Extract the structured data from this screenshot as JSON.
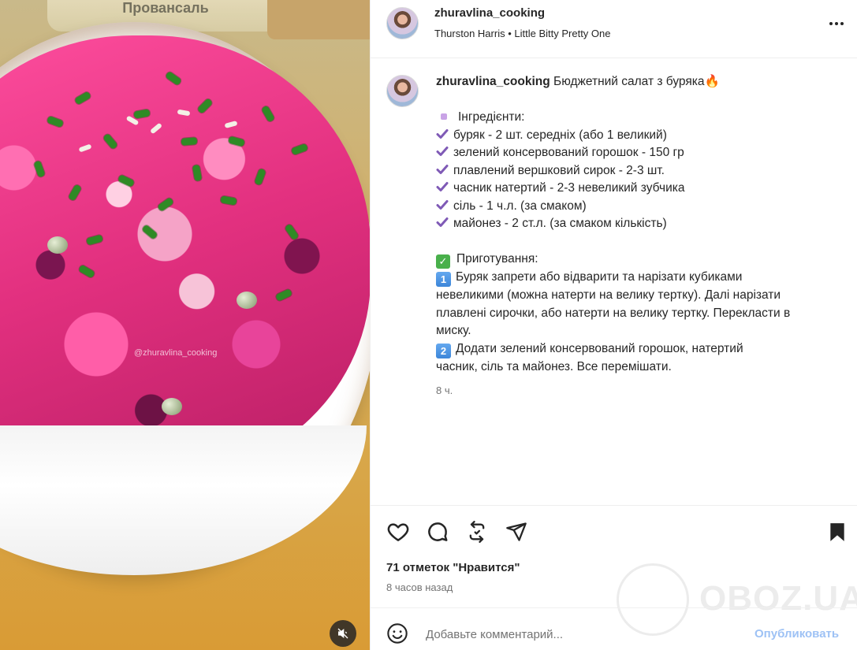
{
  "media": {
    "jar_label": "Провансаль",
    "watermark": "@zhuravlina_cooking",
    "mute_icon": "speaker-muted-icon"
  },
  "header": {
    "username": "zhuravlina_cooking",
    "audio_artist": "Thurston Harris",
    "audio_separator": "•",
    "audio_track": "Little Bitty Pretty One",
    "more_icon": "more-options-icon"
  },
  "caption": {
    "username": "zhuravlina_cooking",
    "title": "Бюджетний салат з буряка🔥",
    "ingredients_header": "Інгредієнти:",
    "ingredients": [
      "буряк - 2 шт. середніх (або 1 великий)",
      "зелений консервований горошок - 150 гр",
      "плавлений вершковий сирок - 2-3 шт.",
      "часник натертий - 2-3 невеликий зубчика",
      "сіль - 1 ч.л. (за смаком)",
      "майонез - 2 ст.л. (за смаком кількість)"
    ],
    "steps_header": "Приготування:",
    "step1_key": "1",
    "step1_lines": [
      "Буряк запрети або відварити та нарізати кубиками",
      "невеликими (можна натерти на велику тертку). Далі нарізати",
      "плавлені сирочки, або натерти на велику тертку. Перекласти в",
      "миску."
    ],
    "step2_key": "2",
    "step2_lines": [
      "Додати зелений консервований горошок, натертий",
      "часник, сіль та майонез. Все перемішати."
    ],
    "time": "8 ч."
  },
  "actions": {
    "like_icon": "heart-icon",
    "comment_icon": "comment-icon",
    "repost_icon": "repost-icon",
    "share_icon": "send-icon",
    "save_icon": "bookmark-icon",
    "likes": "71 отметок \"Нравится\"",
    "posted": "8 часов назад"
  },
  "comment": {
    "emoji_icon": "emoji-icon",
    "placeholder": "Добавьте комментарий...",
    "publish": "Опубликовать"
  },
  "watermark": {
    "text": "OBOZ.UA"
  },
  "colors": {
    "check_purple": "#7f5ab6",
    "publish_blue": "#9ec2f5",
    "keycap_blue": "#3d86d9"
  }
}
